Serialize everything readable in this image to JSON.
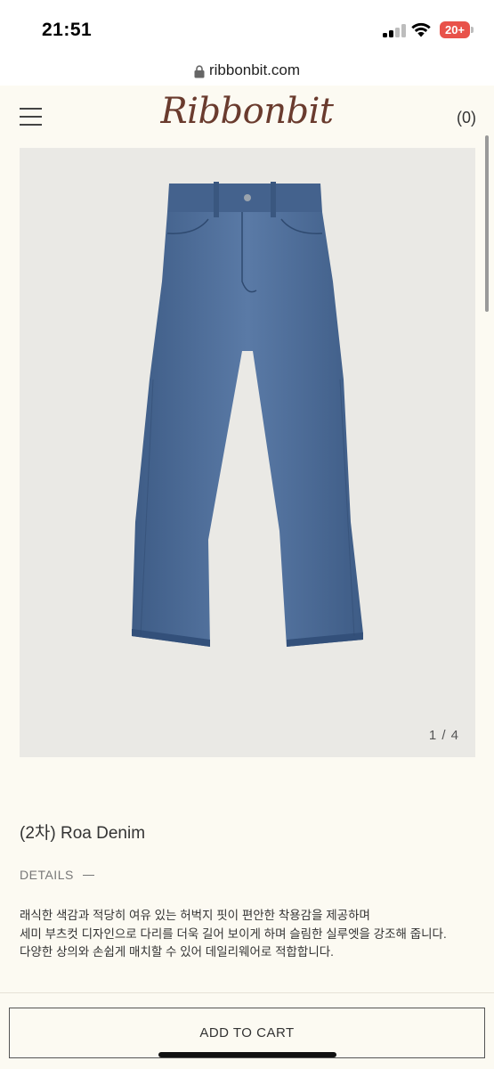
{
  "status_bar": {
    "time": "21:51",
    "battery": "20+",
    "icons": [
      "signal-icon",
      "wifi-icon",
      "battery-icon"
    ],
    "battery_color": "#e8524a"
  },
  "browser": {
    "url": "ribbonbit.com",
    "icon": "lock-icon"
  },
  "header": {
    "logo": "Ribbonbit",
    "cart": "(0)",
    "menu_icon": "hamburger-menu-icon",
    "logo_color": "#6a3b2e"
  },
  "product": {
    "image_alt": "blue denim jeans",
    "image_counter": "1 / 4",
    "title": "(2차) Roa Denim",
    "details_label": "DETAILS",
    "description": [
      "래식한 색감과 적당히 여유 있는 허벅지 핏이 편안한 착용감을 제공하며",
      "세미 부츠컷 디자인으로 다리를 더욱 길어 보이게 하며 슬림한 실루엣을 강조해 줍니다.",
      "다양한 상의와 손쉽게 매치할 수 있어 데일리웨어로 적합합니다."
    ]
  },
  "actions": {
    "add_to_cart": "ADD TO CART"
  },
  "colors": {
    "background": "#fcfaf2",
    "image_bg": "#eae9e5",
    "denim": "#4f6f9a"
  }
}
